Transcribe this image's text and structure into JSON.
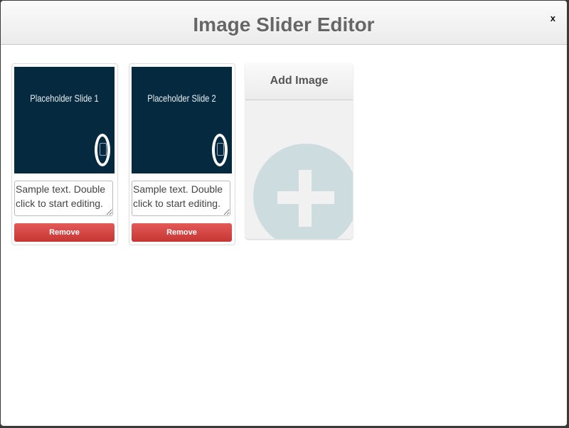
{
  "title": "Image Slider Editor",
  "close_label": "x",
  "slides": [
    {
      "caption": "Placeholder Slide 1",
      "text": "Sample text. Double click to start editing.",
      "remove_label": "Remove"
    },
    {
      "caption": "Placeholder Slide 2",
      "text": "Sample text. Double click to start editing.",
      "remove_label": "Remove"
    }
  ],
  "add": {
    "label": "Add Image",
    "icon": "plus-circle-icon"
  },
  "colors": {
    "slide_bg": "#052a40",
    "remove": "#d44a48",
    "add_icon": "#cddddf"
  }
}
